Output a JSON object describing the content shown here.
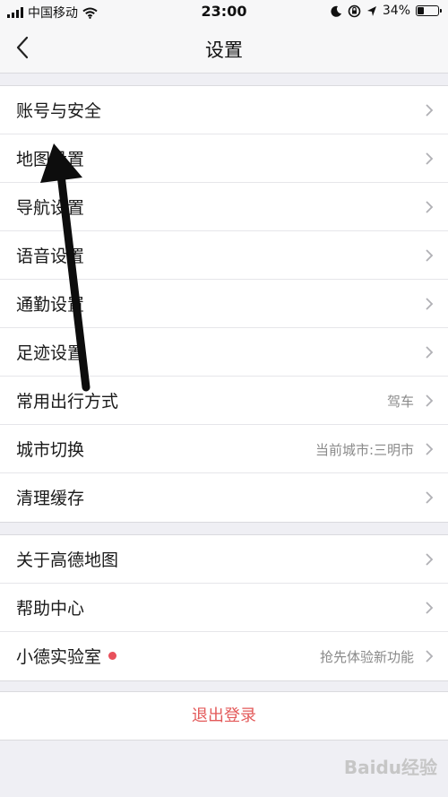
{
  "status_bar": {
    "carrier": "中国移动",
    "time": "23:00",
    "battery": "34%",
    "battery_level": 0.34
  },
  "header": {
    "title": "设置",
    "back_icon": "chevron-left-icon"
  },
  "groups": [
    {
      "rows": [
        {
          "label": "账号与安全",
          "value": ""
        },
        {
          "label": "地图设置",
          "value": ""
        },
        {
          "label": "导航设置",
          "value": ""
        },
        {
          "label": "语音设置",
          "value": ""
        },
        {
          "label": "通勤设置",
          "value": ""
        },
        {
          "label": "足迹设置",
          "value": ""
        },
        {
          "label": "常用出行方式",
          "value": "驾车"
        },
        {
          "label": "城市切换",
          "value": "当前城市:三明市"
        },
        {
          "label": "清理缓存",
          "value": ""
        }
      ]
    },
    {
      "rows": [
        {
          "label": "关于高德地图",
          "value": ""
        },
        {
          "label": "帮助中心",
          "value": ""
        },
        {
          "label": "小德实验室",
          "value": "抢先体验新功能"
        }
      ]
    }
  ],
  "logout_label": "退出登录",
  "watermark": "Baidu经验",
  "colors": {
    "logout": "#e35a5a",
    "dot": "#e8505b",
    "background": "#efeff4"
  }
}
